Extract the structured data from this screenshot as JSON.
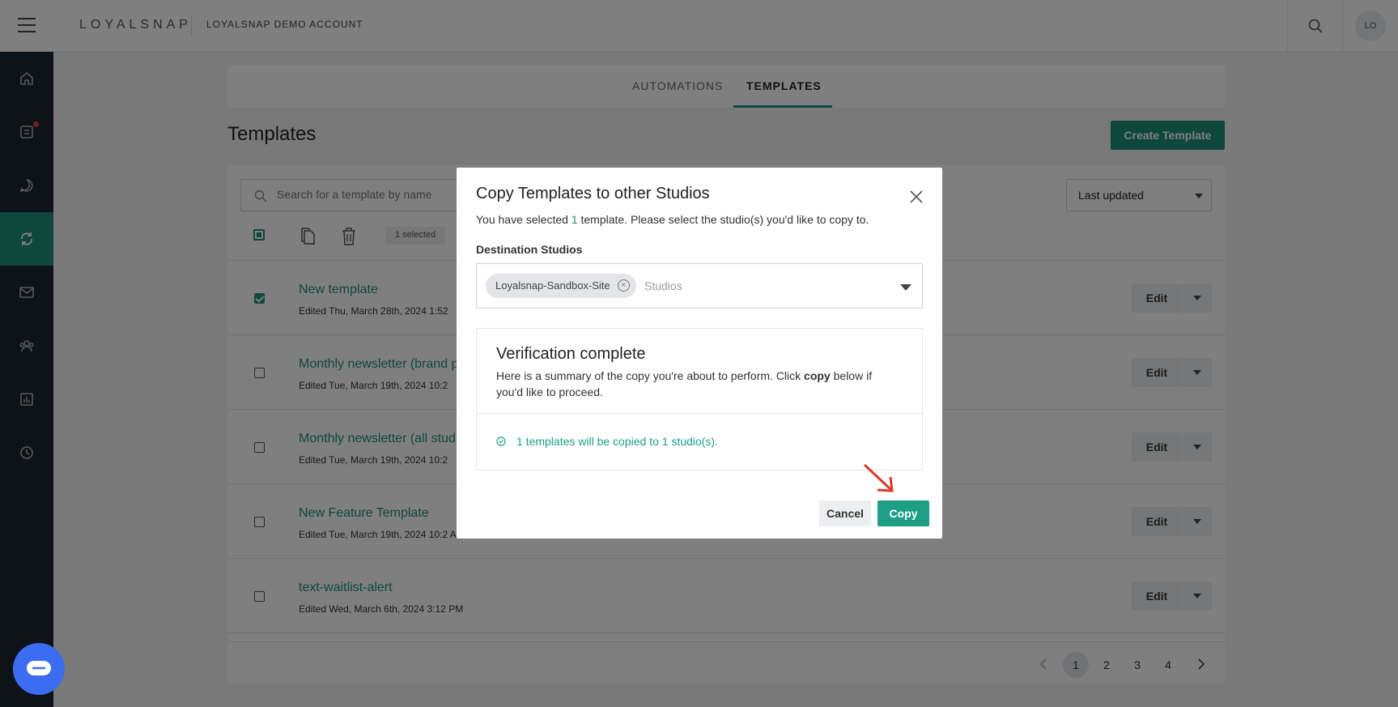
{
  "header": {
    "logo": "LOYALSNAP",
    "account_name": "LOYALSNAP DEMO ACCOUNT",
    "avatar_initials": "LO"
  },
  "tabs": [
    {
      "label": "AUTOMATIONS"
    },
    {
      "label": "TEMPLATES"
    }
  ],
  "page": {
    "title": "Templates",
    "create_button": "Create Template",
    "search_placeholder": "Search for a template by name",
    "sort_value": "Last updated",
    "selected_count": "1 selected"
  },
  "rows": [
    {
      "name": "New template",
      "edited": "Edited Thu, March 28th, 2024 1:52",
      "checked": true
    },
    {
      "name": "Monthly newsletter (brand p",
      "edited": "Edited Tue, March 19th, 2024 10:2",
      "checked": false
    },
    {
      "name": "Monthly newsletter (all stud",
      "edited": "Edited Tue, March 19th, 2024 10:2",
      "checked": false
    },
    {
      "name": "New Feature Template",
      "edited": "Edited Tue, March 19th, 2024 10:2 AM",
      "checked": false
    },
    {
      "name": "text-waitlist-alert",
      "edited": "Edited Wed, March 6th, 2024 3:12 PM",
      "checked": false
    }
  ],
  "row_edit_label": "Edit",
  "pagination": {
    "pages": [
      "1",
      "2",
      "3",
      "4"
    ],
    "current": "1"
  },
  "modal": {
    "title": "Copy Templates to other Studios",
    "subtitle_pre": "You have selected ",
    "subtitle_count": "1",
    "subtitle_post": " template. Please select the studio(s) you'd like to copy to.",
    "destination_label": "Destination Studios",
    "chip": "Loyalsnap-Sandbox-Site",
    "placeholder": "Studios",
    "verify_title": "Verification complete",
    "verify_body_pre": "Here is a summary of the copy you're about to perform. Click ",
    "verify_body_bold": "copy",
    "verify_body_post": " below if you'd like to proceed.",
    "result": "1 templates will be copied to 1 studio(s).",
    "cancel": "Cancel",
    "copy": "Copy"
  },
  "colors": {
    "accent": "#1f8f7a",
    "sidebar": "#1d2735",
    "chat": "#3c6df0",
    "arrow": "#d93a2b"
  }
}
